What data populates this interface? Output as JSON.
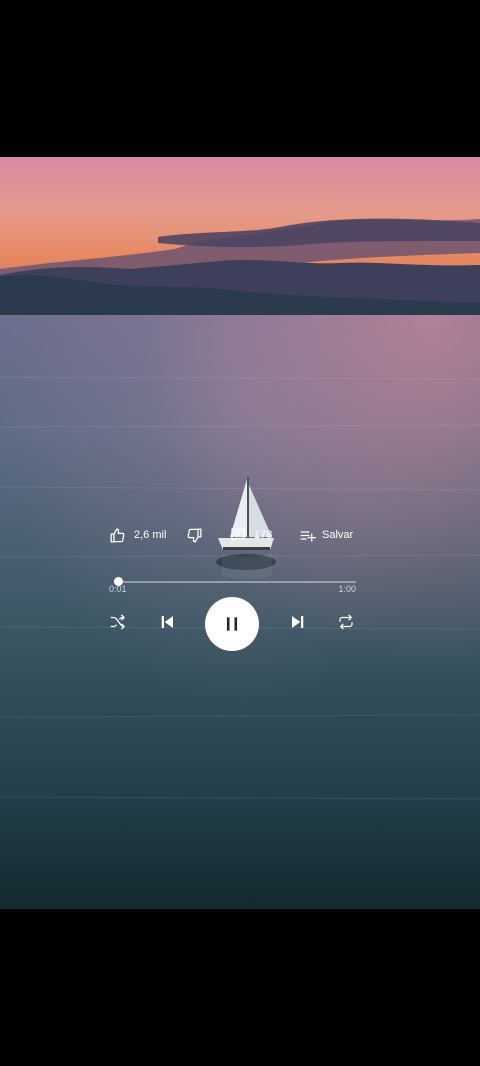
{
  "video": {
    "scene": "sailboat-on-lake-at-sunset"
  },
  "actions": {
    "likes_label": "2,6 mil",
    "comments_label": "178",
    "save_label": "Salvar"
  },
  "player": {
    "current_time": "0:01",
    "duration": "1:00",
    "progress": 0.017,
    "state": "playing"
  },
  "icons": {
    "like": "thumb-up-icon",
    "dislike": "thumb-down-icon",
    "comments": "comment-icon",
    "save": "playlist-add-icon",
    "shuffle": "shuffle-icon",
    "previous": "skip-previous-icon",
    "pause": "pause-icon",
    "next": "skip-next-icon",
    "repeat": "repeat-icon"
  }
}
